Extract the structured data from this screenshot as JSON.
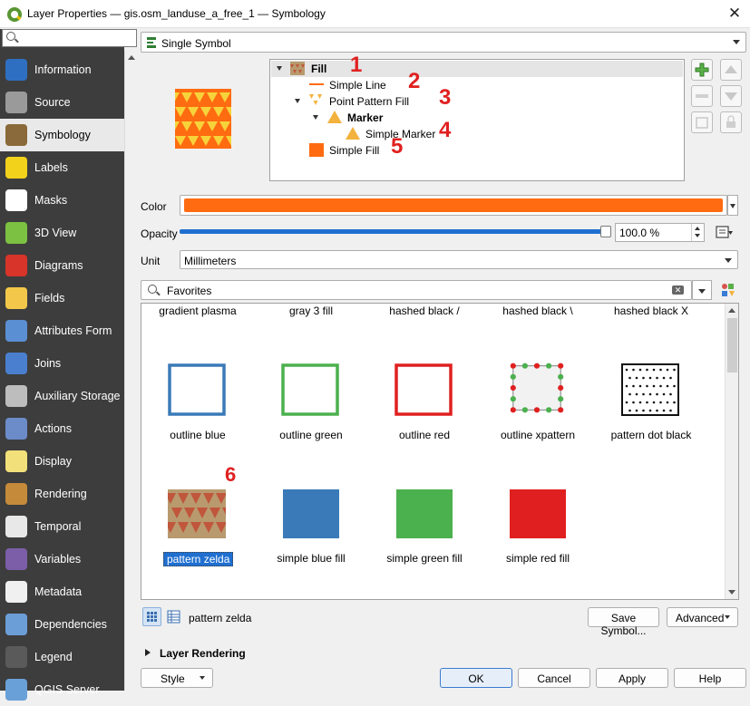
{
  "window": {
    "title": "Layer Properties — gis.osm_landuse_a_free_1 — Symbology",
    "close_glyph": "✕"
  },
  "sidebar": {
    "search_placeholder": "",
    "items": [
      {
        "label": "Information",
        "icon": "information-icon",
        "color": "#2f6fc1"
      },
      {
        "label": "Source",
        "icon": "source-icon",
        "color": "#9a9a9a"
      },
      {
        "label": "Symbology",
        "icon": "symbology-icon",
        "color": "#8a6a3a",
        "active": true
      },
      {
        "label": "Labels",
        "icon": "labels-icon",
        "color": "#f2d21b"
      },
      {
        "label": "Masks",
        "icon": "masks-icon",
        "color": "#ffffff"
      },
      {
        "label": "3D View",
        "icon": "3d-view-icon",
        "color": "#7cc142"
      },
      {
        "label": "Diagrams",
        "icon": "diagrams-icon",
        "color": "#d8342a"
      },
      {
        "label": "Fields",
        "icon": "fields-icon",
        "color": "#f3c84a"
      },
      {
        "label": "Attributes Form",
        "icon": "attributes-form-icon",
        "color": "#5b8fd3"
      },
      {
        "label": "Joins",
        "icon": "joins-icon",
        "color": "#4a7fcf"
      },
      {
        "label": "Auxiliary Storage",
        "icon": "auxiliary-storage-icon",
        "color": "#bdbdbd"
      },
      {
        "label": "Actions",
        "icon": "actions-icon",
        "color": "#6b8cc9"
      },
      {
        "label": "Display",
        "icon": "display-icon",
        "color": "#f2e07a"
      },
      {
        "label": "Rendering",
        "icon": "rendering-icon",
        "color": "#c58a3a"
      },
      {
        "label": "Temporal",
        "icon": "temporal-icon",
        "color": "#e8e8e8"
      },
      {
        "label": "Variables",
        "icon": "variables-icon",
        "color": "#7b5ea7"
      },
      {
        "label": "Metadata",
        "icon": "metadata-icon",
        "color": "#f0f0f0"
      },
      {
        "label": "Dependencies",
        "icon": "dependencies-icon",
        "color": "#6b9ed6"
      },
      {
        "label": "Legend",
        "icon": "legend-icon",
        "color": "#5a5a5a"
      },
      {
        "label": "QGIS Server",
        "icon": "qgis-server-icon",
        "color": "#6aa0d8"
      }
    ]
  },
  "renderer": {
    "selected": "Single Symbol"
  },
  "symbol_tree": [
    {
      "label": "Fill",
      "num": "1",
      "bold": true
    },
    {
      "label": "Simple Line",
      "num": "2",
      "bold": false
    },
    {
      "label": "Point Pattern Fill",
      "num": "3",
      "bold": false
    },
    {
      "label": "Marker",
      "num": "",
      "bold": true
    },
    {
      "label": "Simple Marker",
      "num": "4",
      "bold": false
    },
    {
      "label": "Simple Fill",
      "num": "5",
      "bold": false
    }
  ],
  "properties": {
    "color_label": "Color",
    "color_value": "#ff6b11",
    "opacity_label": "Opacity",
    "opacity_value": "100.0 %",
    "opacity_fraction": 1.0,
    "unit_label": "Unit",
    "unit_value": "Millimeters"
  },
  "library": {
    "search_value": "Favorites",
    "top_row": [
      "gradient  plasma",
      "gray 3 fill",
      "hashed black /",
      "hashed black \\",
      "hashed black X"
    ],
    "row1": [
      "outline blue",
      "outline green",
      "outline red",
      "outline xpattern",
      "pattern dot black"
    ],
    "row2": [
      "pattern zelda",
      "simple blue fill",
      "simple green fill",
      "simple red fill"
    ],
    "marker_six": "6",
    "selected_name": "pattern zelda"
  },
  "footer": {
    "save_symbol": "Save Symbol...",
    "advanced": "Advanced",
    "layer_rendering": "Layer Rendering",
    "style": "Style",
    "ok": "OK",
    "cancel": "Cancel",
    "apply": "Apply",
    "help": "Help"
  },
  "colors": {
    "orange": "#ff6b11",
    "accent_blue": "#1f6fd0",
    "number_red": "#e02020",
    "zelda_bg": "#b89a6e",
    "zelda_tri": "#c0563c"
  }
}
